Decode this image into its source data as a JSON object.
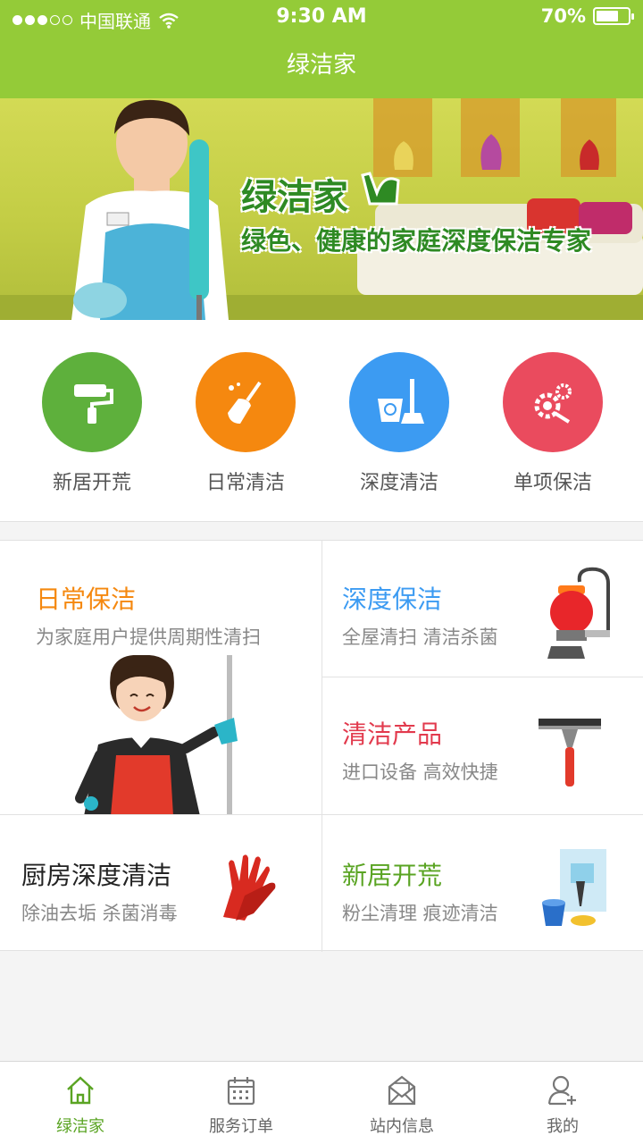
{
  "status_bar": {
    "carrier": "中国联通",
    "time": "9:30 AM",
    "battery_text": "70%",
    "battery_level": 0.7,
    "signal_bars_filled": 3,
    "signal_bars_total": 5,
    "wifi_icon": "wifi-icon"
  },
  "header": {
    "title": "绿洁家"
  },
  "banner": {
    "title": "绿洁家",
    "subtitle": "绿色、健康的家庭深度保洁专家",
    "logo_icon": "leaf-logo-icon"
  },
  "categories": [
    {
      "label": "新居开荒",
      "icon": "paint-roller-icon",
      "color": "#5eb03c"
    },
    {
      "label": "日常清洁",
      "icon": "broom-icon",
      "color": "#f5880f"
    },
    {
      "label": "深度清洁",
      "icon": "bucket-mop-icon",
      "color": "#3c9bf2"
    },
    {
      "label": "单项保洁",
      "icon": "gear-tools-icon",
      "color": "#ea4b5e"
    }
  ],
  "services": {
    "daily": {
      "title": "日常保洁",
      "desc": "为家庭用户提供周期性清扫",
      "color": "#f5880f",
      "icon": "cleaning-lady-icon"
    },
    "deep": {
      "title": "深度保洁",
      "desc": "全屋清扫  清洁杀菌",
      "color": "#3c9bf2",
      "icon": "vacuum-cleaner-icon"
    },
    "products": {
      "title": "清洁产品",
      "desc": "进口设备  高效快捷",
      "color": "#e23a4d",
      "icon": "squeegee-icon"
    },
    "kitchen": {
      "title": "厨房深度清洁",
      "desc": "除油去垢  杀菌消毒",
      "color": "#222222",
      "icon": "rubber-gloves-icon"
    },
    "new_home": {
      "title": "新居开荒",
      "desc": "粉尘清理  痕迹清洁",
      "color": "#5aa423",
      "icon": "window-bucket-icon"
    }
  },
  "tabbar": [
    {
      "label": "绿洁家",
      "icon": "home-icon",
      "active": true
    },
    {
      "label": "服务订单",
      "icon": "calendar-icon",
      "active": false
    },
    {
      "label": "站内信息",
      "icon": "mail-icon",
      "active": false
    },
    {
      "label": "我的",
      "icon": "user-add-icon",
      "active": false
    }
  ],
  "colors": {
    "brand_green": "#94cb38",
    "active_tab": "#5aa423"
  }
}
